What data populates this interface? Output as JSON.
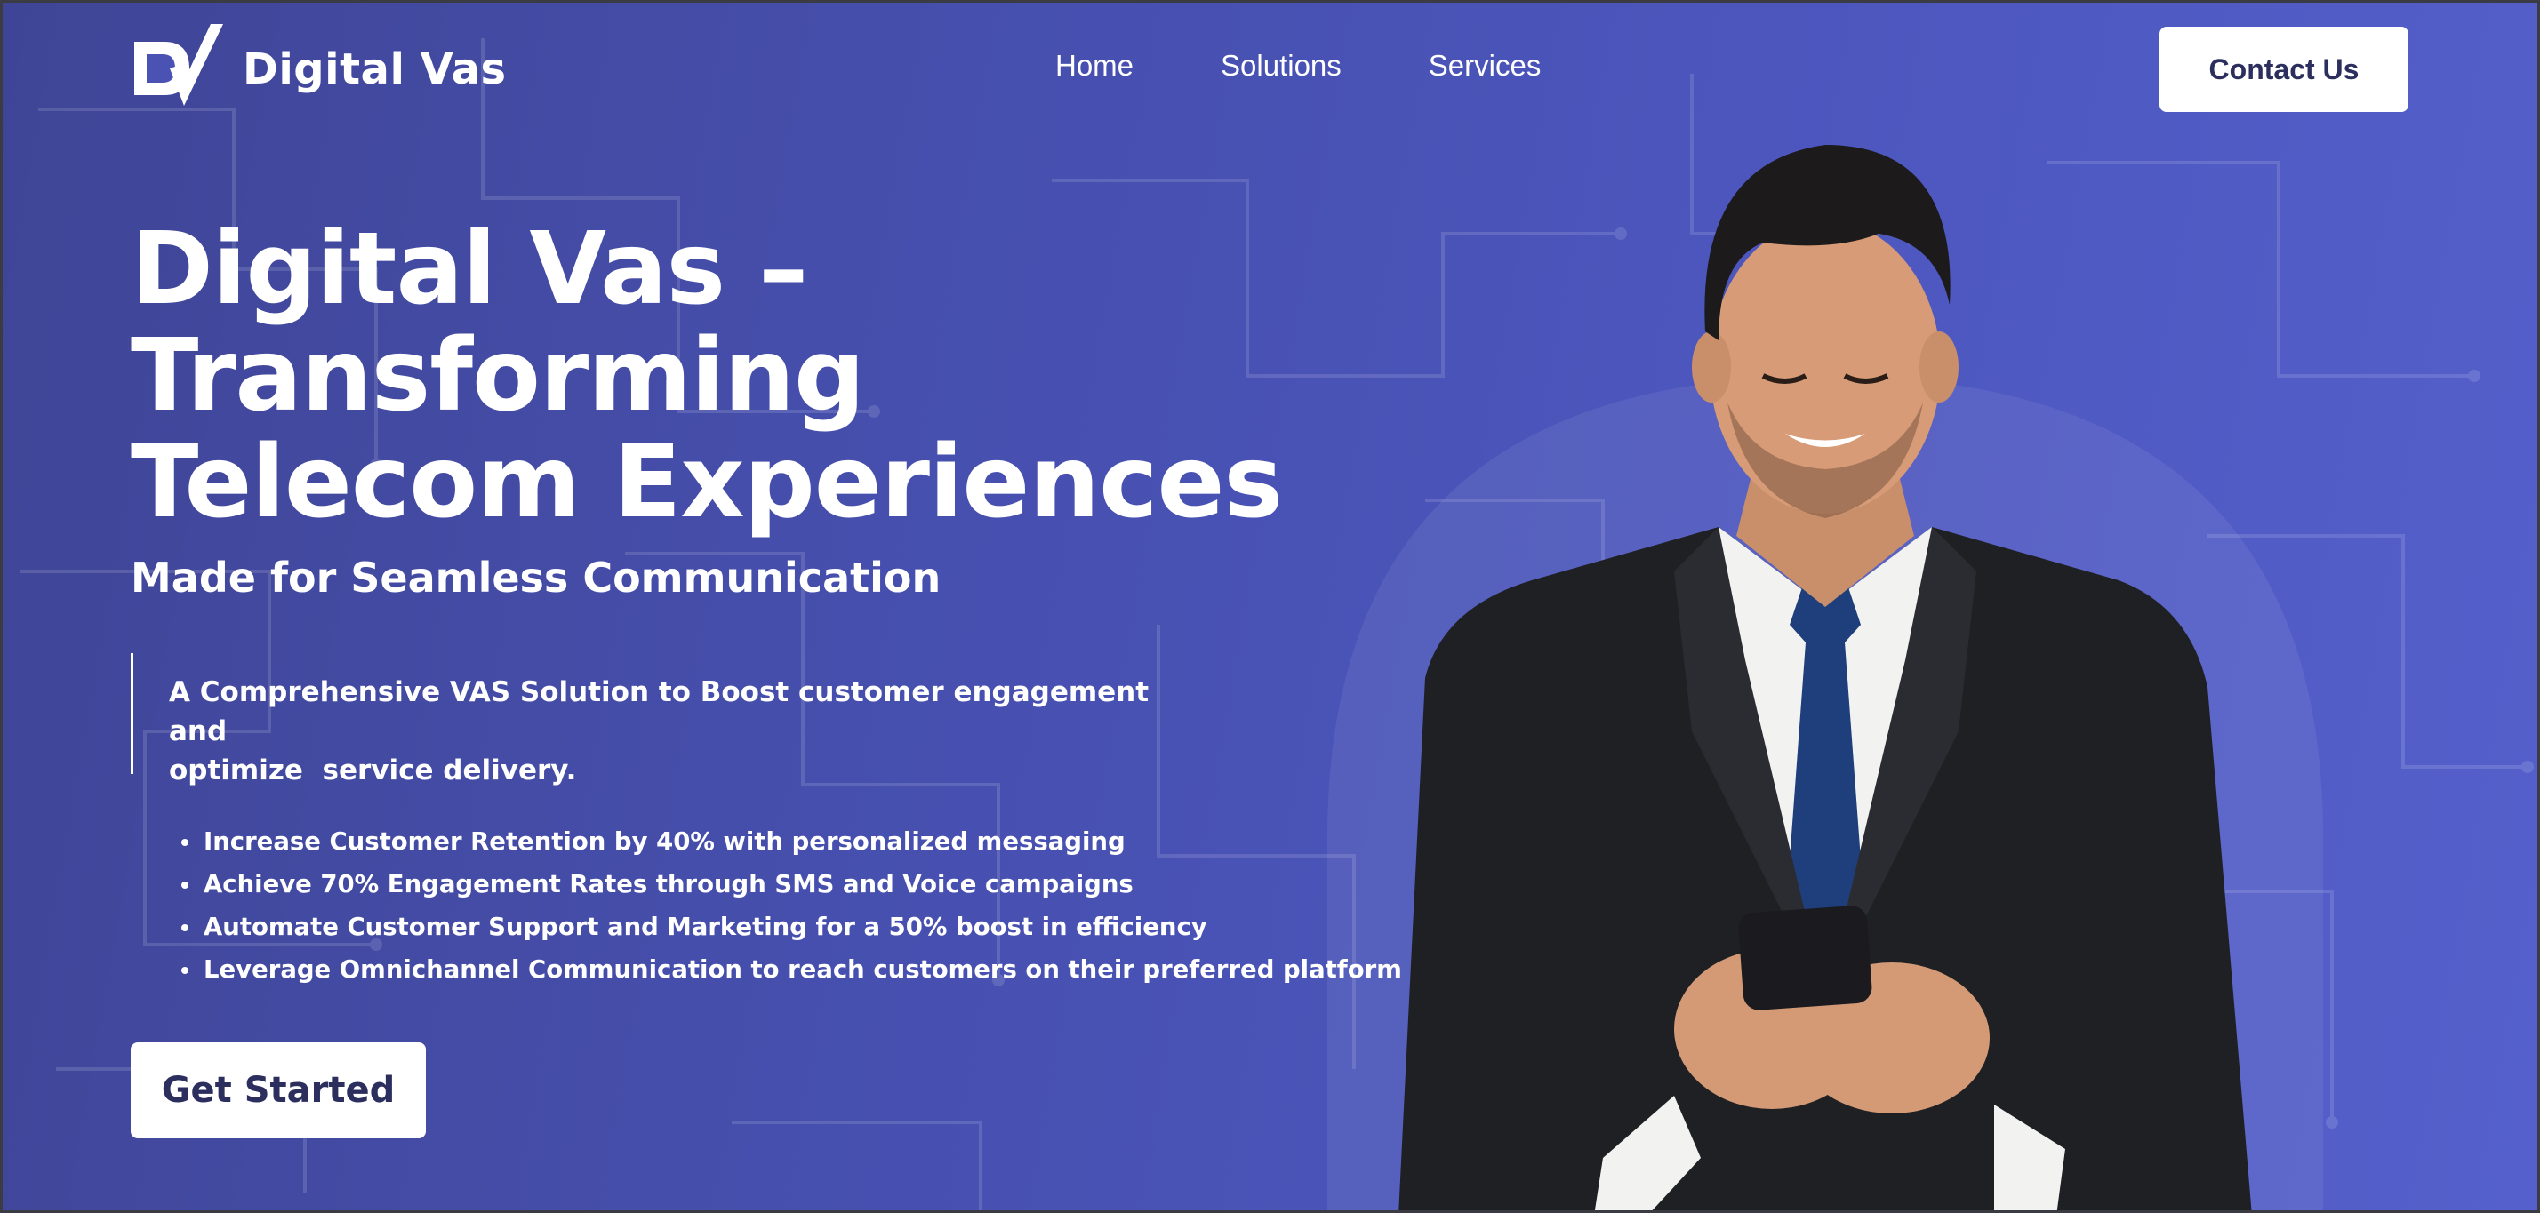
{
  "brand": {
    "name": "Digital Vas",
    "logo_icon": "dv-logo-icon"
  },
  "nav": {
    "items": [
      {
        "label": "Home"
      },
      {
        "label": "Solutions"
      },
      {
        "label": "Services"
      }
    ],
    "contact_label": "Contact Us"
  },
  "hero": {
    "headline_line1": "Digital Vas –",
    "headline_line2": "Transforming",
    "headline_line3": "Telecom Experiences",
    "subhead": "Made for Seamless Communication",
    "intro": "A Comprehensive VAS Solution to Boost customer engagement and\noptimize  service delivery.",
    "benefits": [
      "Increase Customer Retention by 40% with personalized messaging",
      "Achieve 70% Engagement Rates through SMS and Voice campaigns",
      "Automate Customer Support and Marketing for a 50% boost in efficiency",
      "Leverage Omnichannel Communication to reach customers on their preferred platform"
    ],
    "cta_label": "Get Started",
    "image": "businessman-with-smartphone"
  },
  "colors": {
    "background_start": "#3f4596",
    "background_end": "#5560cc",
    "button_bg": "#ffffff",
    "button_text": "#2c2f5e"
  }
}
